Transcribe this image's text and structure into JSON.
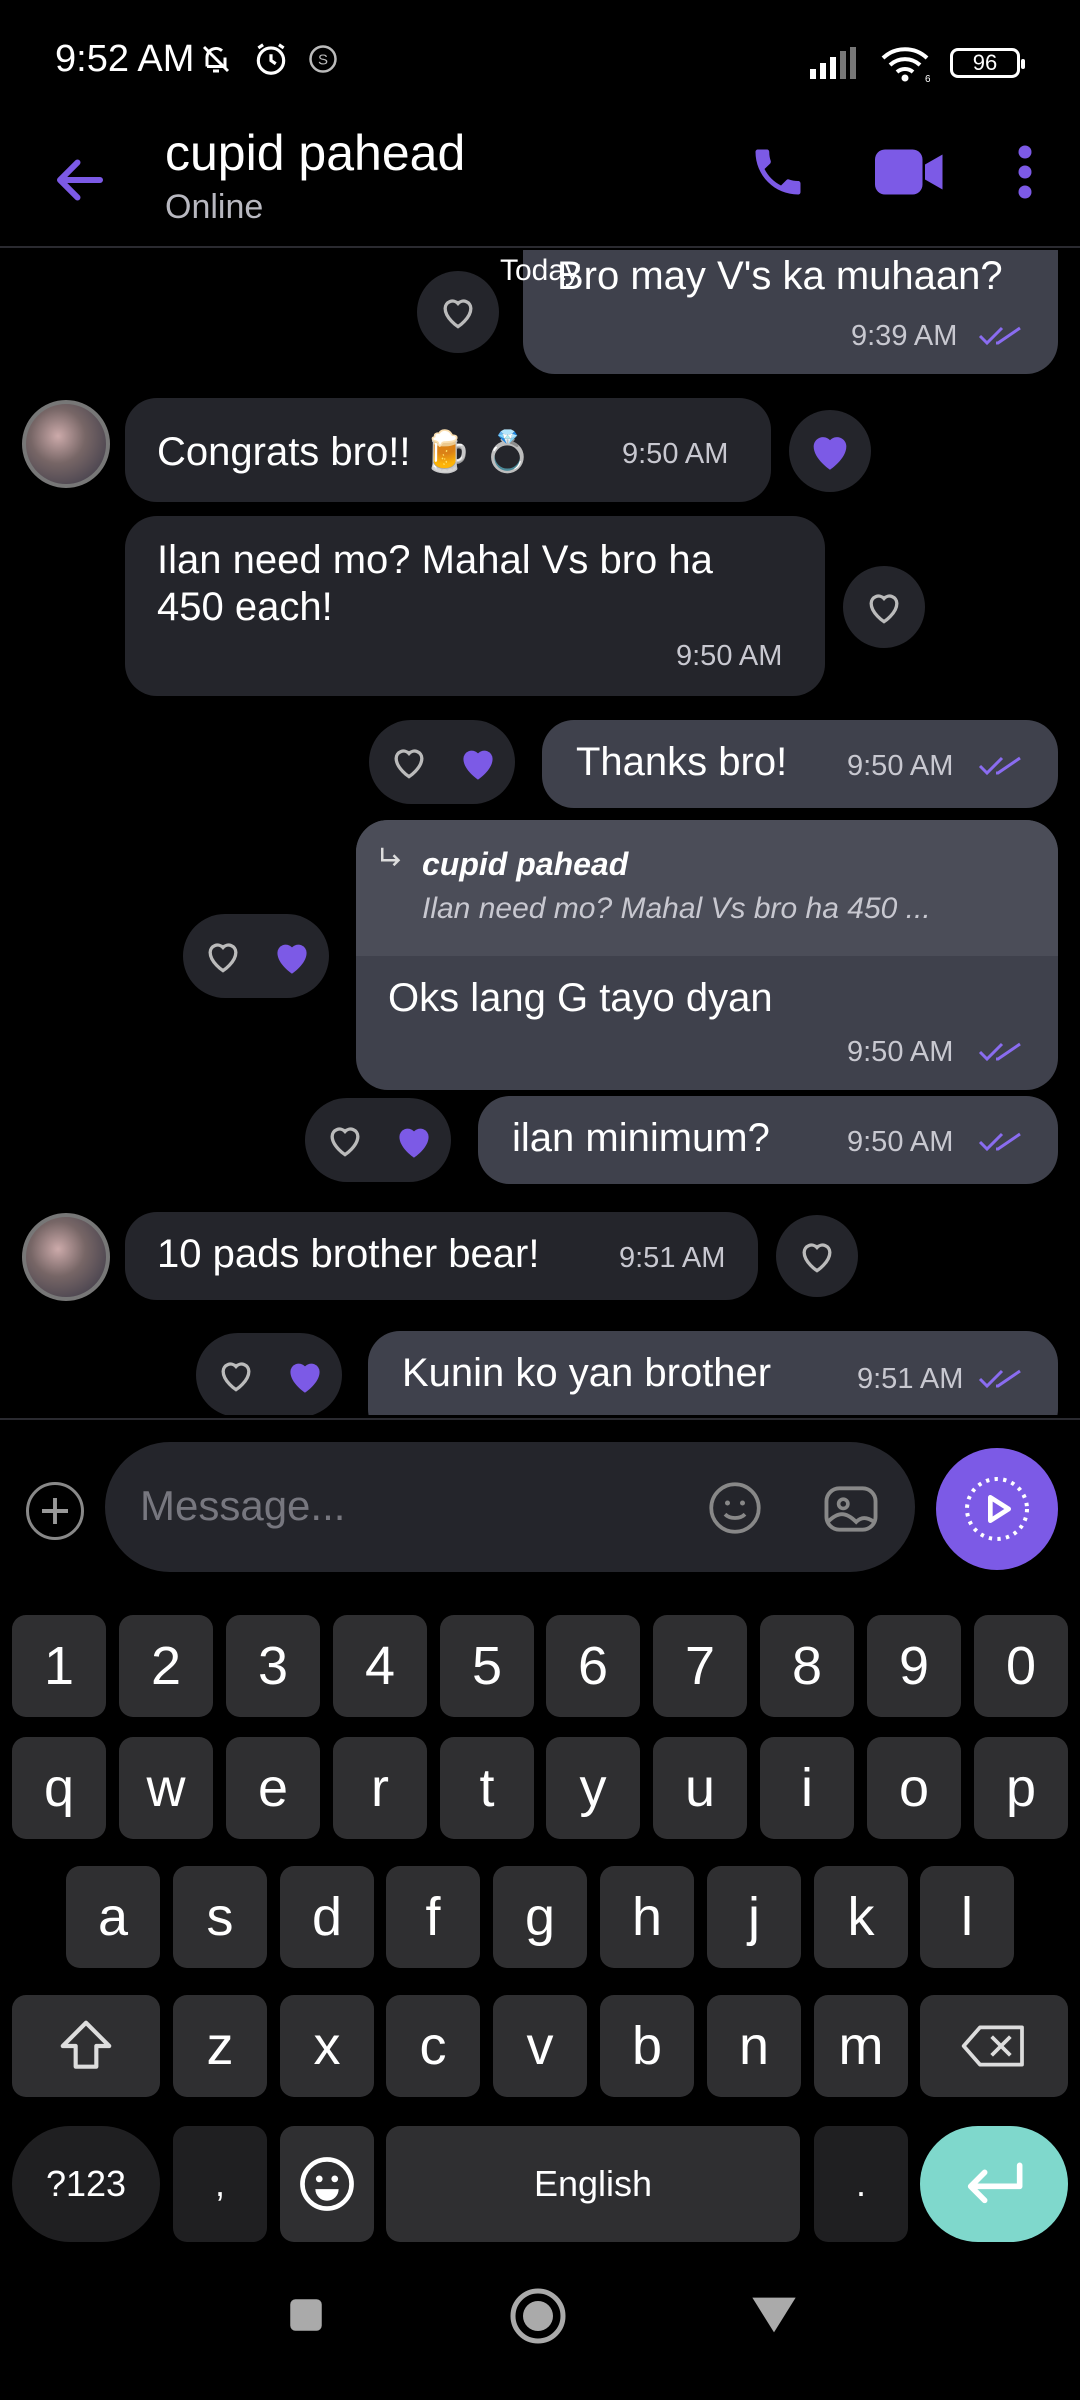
{
  "status_bar": {
    "time": "9:52 AM",
    "battery": "96",
    "wifi_badge": "6",
    "s_badge": "S"
  },
  "header": {
    "title": "cupid pahead",
    "subtitle": "Online"
  },
  "chat": {
    "date_label": "Today",
    "messages": [
      {
        "dir": "out",
        "text": "Bro may V's ka muhaan?",
        "time": "9:39 AM"
      },
      {
        "dir": "in",
        "text": "Congrats bro!! 🍺 💍",
        "time": "9:50 AM"
      },
      {
        "dir": "in",
        "text_line1": "Ilan need mo? Mahal Vs bro ha",
        "text_line2": "450 each!",
        "time": "9:50 AM"
      },
      {
        "dir": "out",
        "text": "Thanks bro!",
        "time": "9:50 AM"
      },
      {
        "dir": "out",
        "reply_name": "cupid pahead",
        "reply_snippet": "Ilan need mo? Mahal Vs bro ha 450 ...",
        "text": "Oks lang G tayo dyan",
        "time": "9:50 AM"
      },
      {
        "dir": "out",
        "text": "ilan minimum?",
        "time": "9:50 AM"
      },
      {
        "dir": "in",
        "text": "10 pads brother bear!",
        "time": "9:51 AM"
      },
      {
        "dir": "out",
        "text": "Kunin ko yan brother",
        "time": "9:51 AM"
      }
    ]
  },
  "composer": {
    "placeholder": "Message..."
  },
  "keyboard": {
    "row_numbers": [
      "1",
      "2",
      "3",
      "4",
      "5",
      "6",
      "7",
      "8",
      "9",
      "0"
    ],
    "row1": [
      "q",
      "w",
      "e",
      "r",
      "t",
      "y",
      "u",
      "i",
      "o",
      "p"
    ],
    "row2": [
      "a",
      "s",
      "d",
      "f",
      "g",
      "h",
      "j",
      "k",
      "l"
    ],
    "row3": [
      "z",
      "x",
      "c",
      "v",
      "b",
      "n",
      "m"
    ],
    "symbols_label": "?123",
    "comma": ",",
    "space_label": "English",
    "period": "."
  },
  "colors": {
    "accent": "#7c5ae6",
    "enter_key": "#7fd8cc",
    "bubble_out": "#3f414c",
    "bubble_in": "#24252b"
  }
}
